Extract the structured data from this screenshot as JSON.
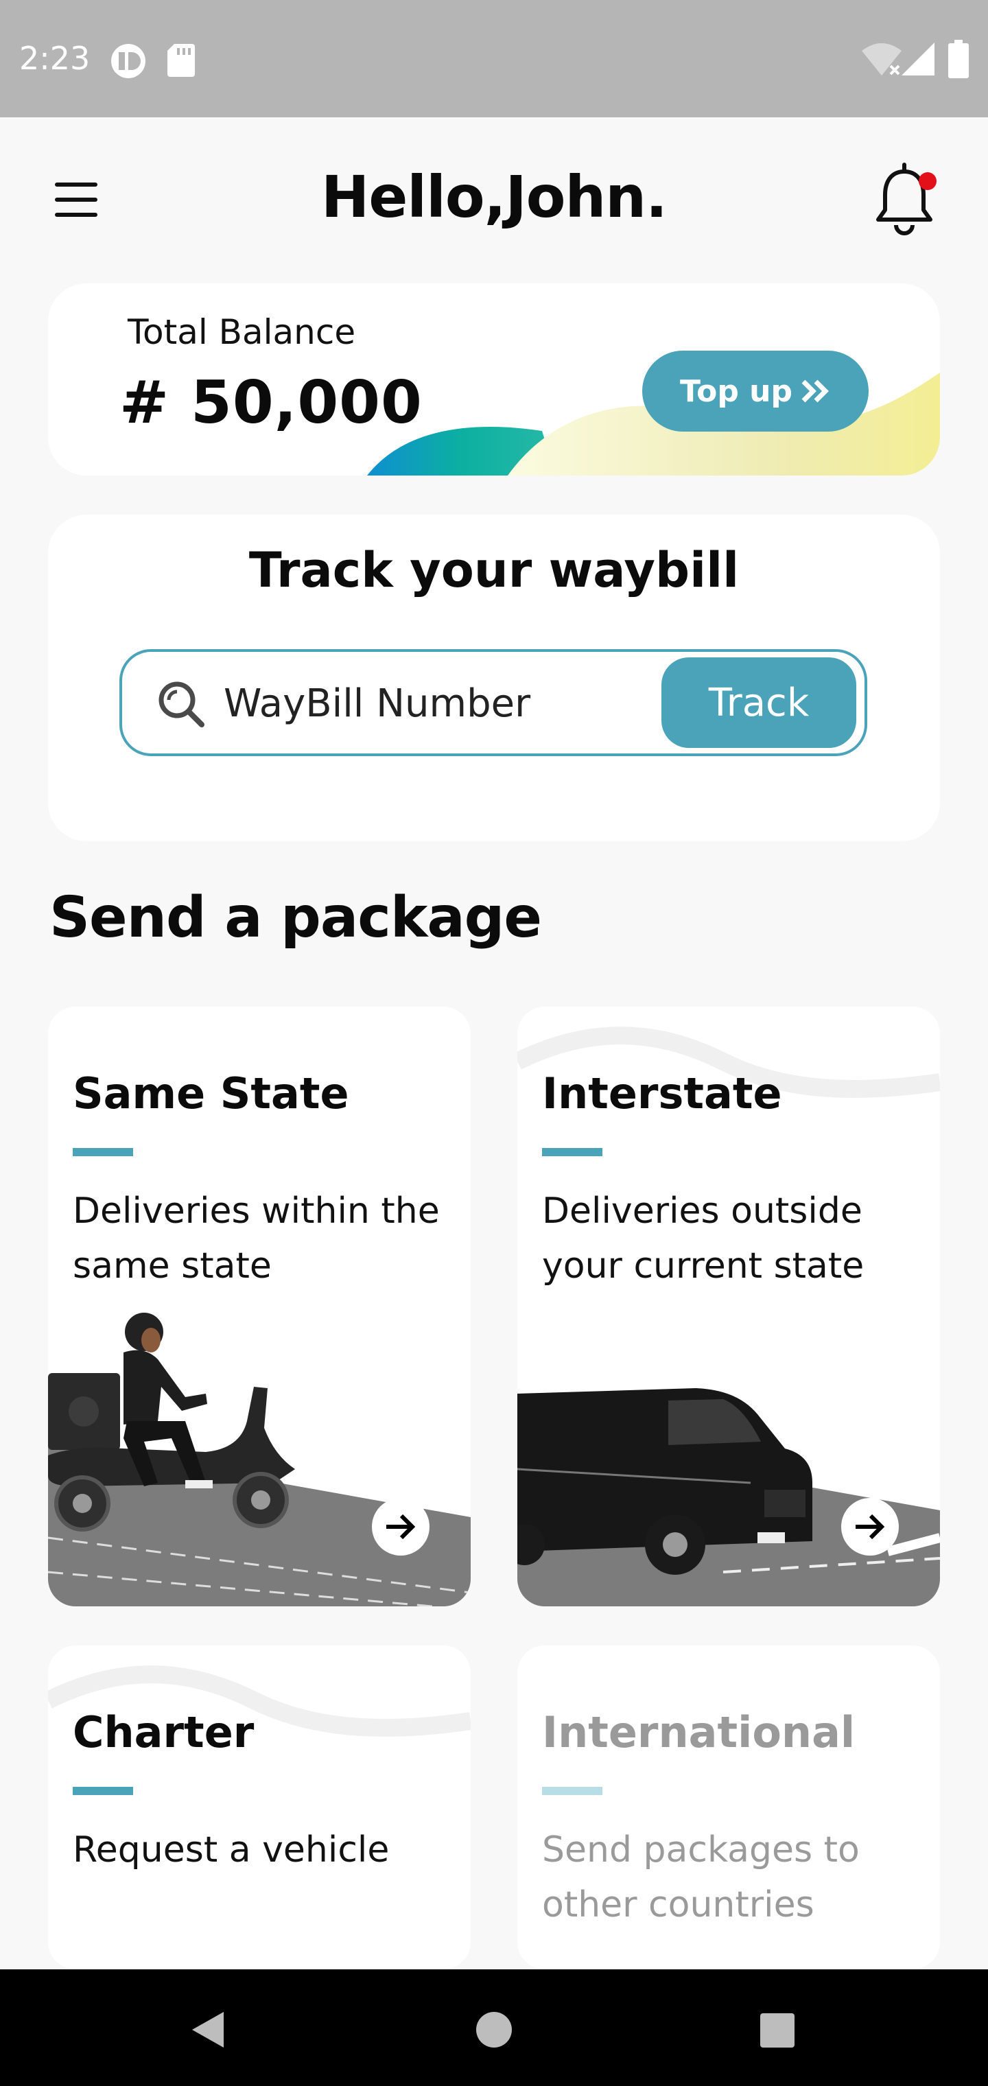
{
  "status_bar": {
    "time": "2:23",
    "icons": [
      "app-notification-icon",
      "sd-card-icon",
      "wifi-off-icon",
      "signal-icon",
      "battery-icon"
    ]
  },
  "header": {
    "greeting": "Hello,John.",
    "menu_icon": "hamburger-menu-icon",
    "notification_icon": "bell-icon",
    "has_unread_notification": true
  },
  "balance": {
    "label": "Total Balance",
    "value": "# 50,000",
    "topup_label": "Top up",
    "topup_icon": "double-chevron-right-icon"
  },
  "track": {
    "title": "Track your waybill",
    "placeholder": "WayBill Number",
    "button_label": "Track"
  },
  "send": {
    "title": "Send a package",
    "cards": [
      {
        "title": "Same State",
        "description": "Deliveries within the same state",
        "illustration": "scooter-rider-image",
        "arrow_icon": "arrow-right-icon",
        "enabled": true
      },
      {
        "title": "Interstate",
        "description": "Deliveries outside your current state",
        "illustration": "van-image",
        "arrow_icon": "arrow-right-icon",
        "enabled": true
      },
      {
        "title": "Charter",
        "description": "Request a vehicle",
        "enabled": true
      },
      {
        "title": "International",
        "description": "Send packages to other countries",
        "enabled": false
      }
    ]
  },
  "colors": {
    "accent": "#4aa3b9",
    "status_bar": "#b5b5b5",
    "background": "#f8f8f8",
    "notification_dot": "#e3101a"
  },
  "nav_bar": {
    "back_icon": "back-triangle-icon",
    "home_icon": "home-circle-icon",
    "recents_icon": "recents-square-icon"
  }
}
